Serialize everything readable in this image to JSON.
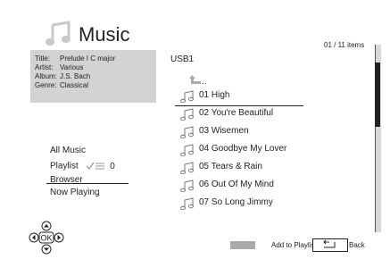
{
  "header": {
    "title": "Music",
    "icon": "music-note-icon"
  },
  "now_playing_info": {
    "title_key": "Title:",
    "title_value": "Prelude I C major",
    "artist_key": "Artist:",
    "artist_value": "Various",
    "album_key": "Album:",
    "album_value": "J.S. Bach",
    "genre_key": "Genre:",
    "genre_value": "Classical"
  },
  "menu": {
    "all_music": "All Music",
    "playlist": "Playlist",
    "playlist_count": "0",
    "browser": "Browser",
    "now_playing": "Now Playing"
  },
  "browser": {
    "item_count": "01 / 11 items",
    "folder": "USB1",
    "parent_label": "..",
    "files": [
      "01 High",
      "02 You're Beautiful",
      "03 Wisemen",
      "04 Goodbye My Lover",
      "05 Tears & Rain",
      "06 Out Of My Mind",
      "07 So Long Jimmy"
    ],
    "selected_index": 0
  },
  "dpad": {
    "center": "OK"
  },
  "footer": {
    "add_to_playlist": "Add to Playlist",
    "back": "Back"
  },
  "colors": {
    "info_panel": "#d3d3d3",
    "legend_swatch": "#aaaaaa",
    "scroll_thumb": "#222222"
  }
}
